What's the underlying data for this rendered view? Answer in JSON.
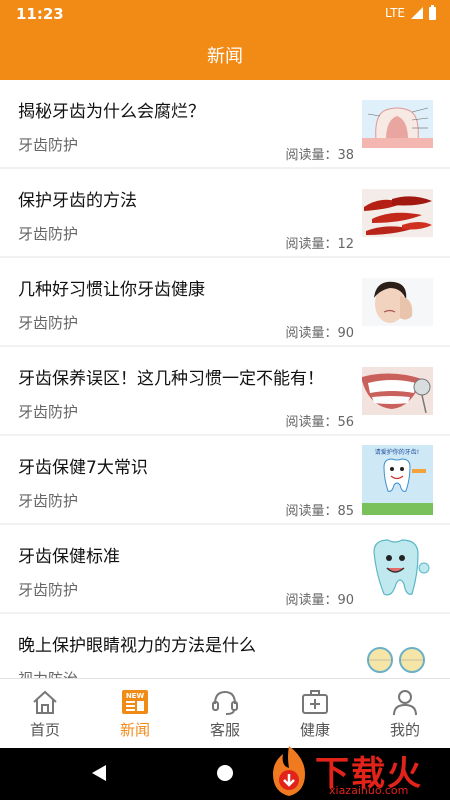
{
  "status_bar": {
    "time": "11:23",
    "network": "LTE"
  },
  "header": {
    "title": "新闻"
  },
  "news": [
    {
      "title": "揭秘牙齿为什么会腐烂？",
      "category": "牙齿防护",
      "reads": "阅读量：38",
      "thumb": "tooth-anatomy-image"
    },
    {
      "title": "保护牙齿的方法",
      "category": "牙齿防护",
      "reads": "阅读量：12",
      "thumb": "red-peppers-image"
    },
    {
      "title": "几种好习惯让你牙齿健康",
      "category": "牙齿防护",
      "reads": "阅读量：90",
      "thumb": "toothache-woman-image"
    },
    {
      "title": "牙齿保养误区！这几种习惯一定不能有！",
      "category": "牙齿防护",
      "reads": "阅读量：56",
      "thumb": "teeth-mirror-image"
    },
    {
      "title": "牙齿保健7大常识",
      "category": "牙齿防护",
      "reads": "阅读量：85",
      "thumb": "cartoon-tooth-brush-image"
    },
    {
      "title": "牙齿保健标准",
      "category": "牙齿防护",
      "reads": "阅读量：90",
      "thumb": "cartoon-tooth-image"
    },
    {
      "title": "晚上保护眼睛视力的方法是什么",
      "category": "视力防治",
      "reads": "",
      "thumb": "eye-diagram-image"
    }
  ],
  "thumb_badge": "请爱护你的牙齿!",
  "tabs": [
    {
      "label": "首页",
      "icon": "home-icon",
      "active": false
    },
    {
      "label": "新闻",
      "icon": "news-icon",
      "active": true,
      "badge": "NEW"
    },
    {
      "label": "客服",
      "icon": "headset-icon",
      "active": false
    },
    {
      "label": "健康",
      "icon": "medical-kit-icon",
      "active": false
    },
    {
      "label": "我的",
      "icon": "user-icon",
      "active": false
    }
  ],
  "watermark": {
    "text": "下载火",
    "url": "xiazaihuo.com"
  },
  "colors": {
    "primary": "#f28a16",
    "watermark": "#e2231a"
  }
}
